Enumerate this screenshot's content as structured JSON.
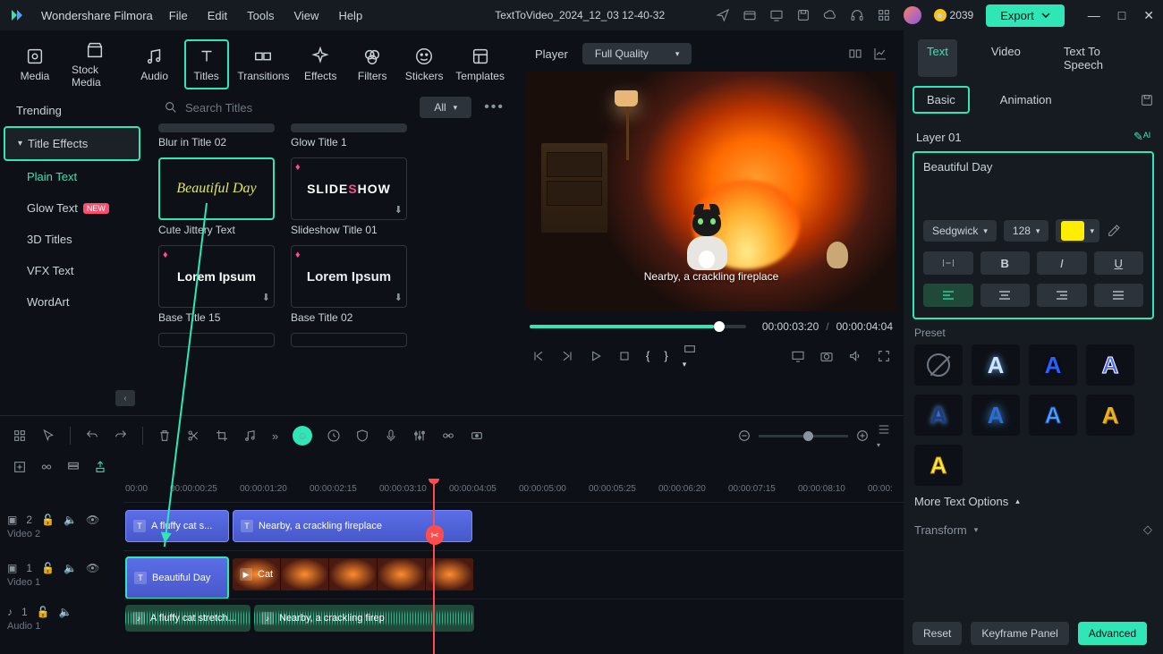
{
  "titlebar": {
    "brand": "Wondershare Filmora",
    "menus": [
      "File",
      "Edit",
      "Tools",
      "View",
      "Help"
    ],
    "project": "TextToVideo_2024_12_03 12-40-32",
    "coins": "2039",
    "export": "Export"
  },
  "mediaTabs": [
    {
      "label": "Media",
      "icon": "film"
    },
    {
      "label": "Stock Media",
      "icon": "shop"
    },
    {
      "label": "Audio",
      "icon": "music"
    },
    {
      "label": "Titles",
      "icon": "text",
      "active": true
    },
    {
      "label": "Transitions",
      "icon": "trans"
    },
    {
      "label": "Effects",
      "icon": "spark"
    },
    {
      "label": "Filters",
      "icon": "filter"
    },
    {
      "label": "Stickers",
      "icon": "smile"
    },
    {
      "label": "Templates",
      "icon": "template"
    }
  ],
  "sideCats": {
    "trending": "Trending",
    "titleEffects": "Title Effects",
    "subs": [
      "Plain Text",
      "Glow Text",
      "3D Titles",
      "VFX Text",
      "WordArt"
    ],
    "new": "NEW"
  },
  "search": {
    "placeholder": "Search Titles",
    "all": "All"
  },
  "titleCards": {
    "r0": {
      "a": "Blur in Title 02",
      "b": "Glow Title 1"
    },
    "r1": {
      "a": "Cute Jittery Text",
      "aText": "Beautiful Day",
      "b": "Slideshow Title 01",
      "bText": "SLIDESHOW"
    },
    "r2": {
      "a": "Base Title 15",
      "aText": "Lorem Ipsum",
      "b": "Base Title 02",
      "bText": "Lorem Ipsum"
    }
  },
  "player": {
    "label": "Player",
    "quality": "Full Quality",
    "caption": "Nearby, a crackling fireplace",
    "timeCurrent": "00:00:03:20",
    "timeTotal": "00:00:04:04"
  },
  "rightPanel": {
    "tabs": [
      "Text",
      "Video",
      "Text To Speech"
    ],
    "subtabs": [
      "Basic",
      "Animation"
    ],
    "layer": "Layer 01",
    "textValue": "Beautiful Day",
    "font": "Sedgwick",
    "size": "128",
    "color": "#ffee00",
    "preset": "Preset",
    "moreOpts": "More Text Options",
    "transform": "Transform",
    "reset": "Reset",
    "keyframe": "Keyframe Panel",
    "advanced": "Advanced"
  },
  "timeline": {
    "ruler": [
      "00:00",
      "00:00:00:25",
      "00:00:01:20",
      "00:00:02:15",
      "00:00:03:10",
      "00:00:04:05",
      "00:00:05:00",
      "00:00:05:25",
      "00:00:06:20",
      "00:00:07:15",
      "00:00:08:10",
      "00:00:"
    ],
    "tracks": {
      "video2": "Video 2",
      "video1": "Video 1",
      "audio1": "Audio 1"
    },
    "clips": {
      "v2a": "A fluffy cat s...",
      "v2b": "Nearby, a crackling fireplace",
      "v1a": "Beautiful Day",
      "v1b": "Cat",
      "a1a": "A fluffy cat stretch...",
      "a1b": "Nearby, a crackling firep"
    }
  }
}
